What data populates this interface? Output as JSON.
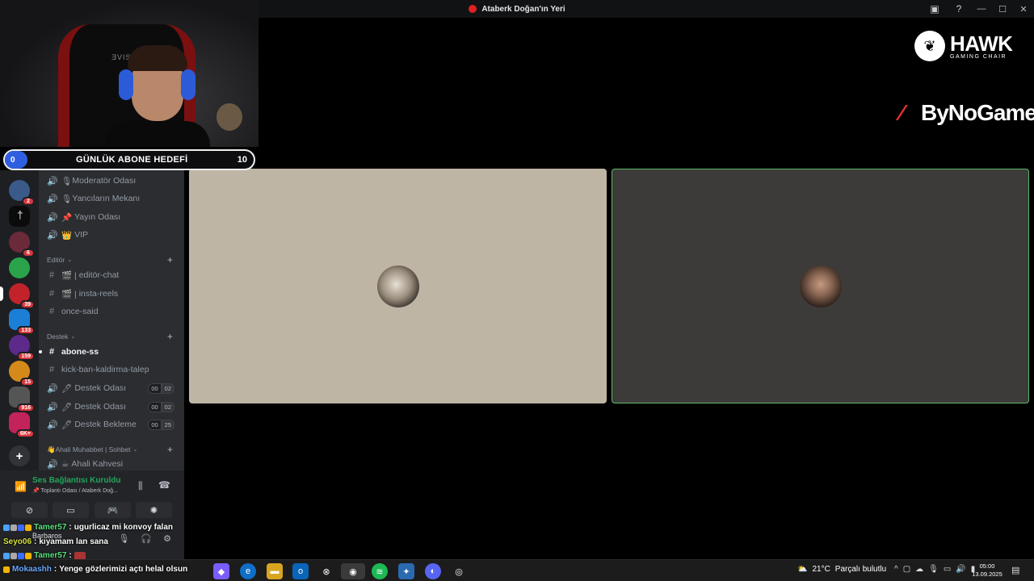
{
  "window": {
    "title": "Ataberk Doğan'ın Yeri"
  },
  "goal": {
    "current": "0",
    "label": "GÜNLÜK ABONE HEDEFİ",
    "target": "10"
  },
  "servers": [
    {
      "badge": "2",
      "color": "#3a5a8a"
    },
    {
      "badge": "",
      "color": "#0b0b0b"
    },
    {
      "badge": "6",
      "color": "#6b2a3a"
    },
    {
      "badge": "",
      "color": "#2aa34a"
    },
    {
      "badge": "39",
      "color": "#c2232a"
    },
    {
      "badge": "133",
      "color": "#1c7fd6"
    },
    {
      "badge": "159",
      "color": "#5b2a8a"
    },
    {
      "badge": "15",
      "color": "#d48a1a"
    },
    {
      "badge": "916",
      "color": "#555555"
    },
    {
      "badge": "6K+",
      "color": "#c2235a"
    }
  ],
  "channels": {
    "top": [
      {
        "type": "voice",
        "label": "Moderatör Odası",
        "emoji": "🎙"
      },
      {
        "type": "voice",
        "label": "Yancıların Mekanı",
        "emoji": "🎙"
      },
      {
        "type": "voice",
        "label": "Yayın Odası",
        "emoji": "📌"
      },
      {
        "type": "voice",
        "label": "VIP",
        "emoji": "👑"
      }
    ],
    "editor_category": "Editör",
    "editor": [
      {
        "type": "text",
        "label": "editör-chat",
        "emoji": "🎬 |"
      },
      {
        "type": "text",
        "label": "insta-reels",
        "emoji": "🎬 |"
      },
      {
        "type": "text",
        "label": "once-said",
        "emoji": ""
      }
    ],
    "destek_category": "Destek",
    "destek": [
      {
        "type": "text",
        "label": "abone-ss",
        "active": true
      },
      {
        "type": "text",
        "label": "kick-ban-kaldirma-talep"
      },
      {
        "type": "voice",
        "label": "Destek Odası",
        "emoji": "🖊",
        "count_a": "00",
        "count_b": "02"
      },
      {
        "type": "voice",
        "label": "Destek Odası",
        "emoji": "🖊",
        "count_a": "00",
        "count_b": "02"
      },
      {
        "type": "voice",
        "label": "Destek Bekleme",
        "emoji": "🖊",
        "count_a": "00",
        "count_b": "25"
      }
    ],
    "ahali_category": "Ahali Muhabbet | Sohbet",
    "ahali_category_emoji": "👋",
    "ahali": [
      {
        "type": "voice",
        "label": "Ahali Kahvesi",
        "emoji": "☕"
      }
    ]
  },
  "voice": {
    "status": "Ses Bağlantısı Kuruldu",
    "sub": "📌 Toplantı Odası / Ataberk Doğ..."
  },
  "user": {
    "name": "Barbaros"
  },
  "chat": [
    {
      "user": "Tamer57",
      "message": "ugurlicaz mi konvoy falan",
      "color": "green"
    },
    {
      "user": "Seyo06",
      "message": "kıyamam lan sana",
      "color": "yellow"
    },
    {
      "user": "Tamer57",
      "message": "",
      "color": "green"
    },
    {
      "user": "Mokaashh",
      "message": "Yenge gözlerimizi açtı helal olsun",
      "color": "blue"
    }
  ],
  "sponsors": {
    "hawk_name": "HAWK",
    "hawk_tag": "GAMING CHAIR",
    "bynogame": "ByNoGame"
  },
  "taskbar": {
    "weather_temp": "21°C",
    "weather_desc": "Parçalı bulutlu",
    "time": "05:00",
    "date": "13.09.2025"
  },
  "colors": {
    "accent_green": "#23a55a",
    "badge_red": "#da373c",
    "goal_blue": "#2f5fe0",
    "tile_border": "#5eb86a"
  }
}
